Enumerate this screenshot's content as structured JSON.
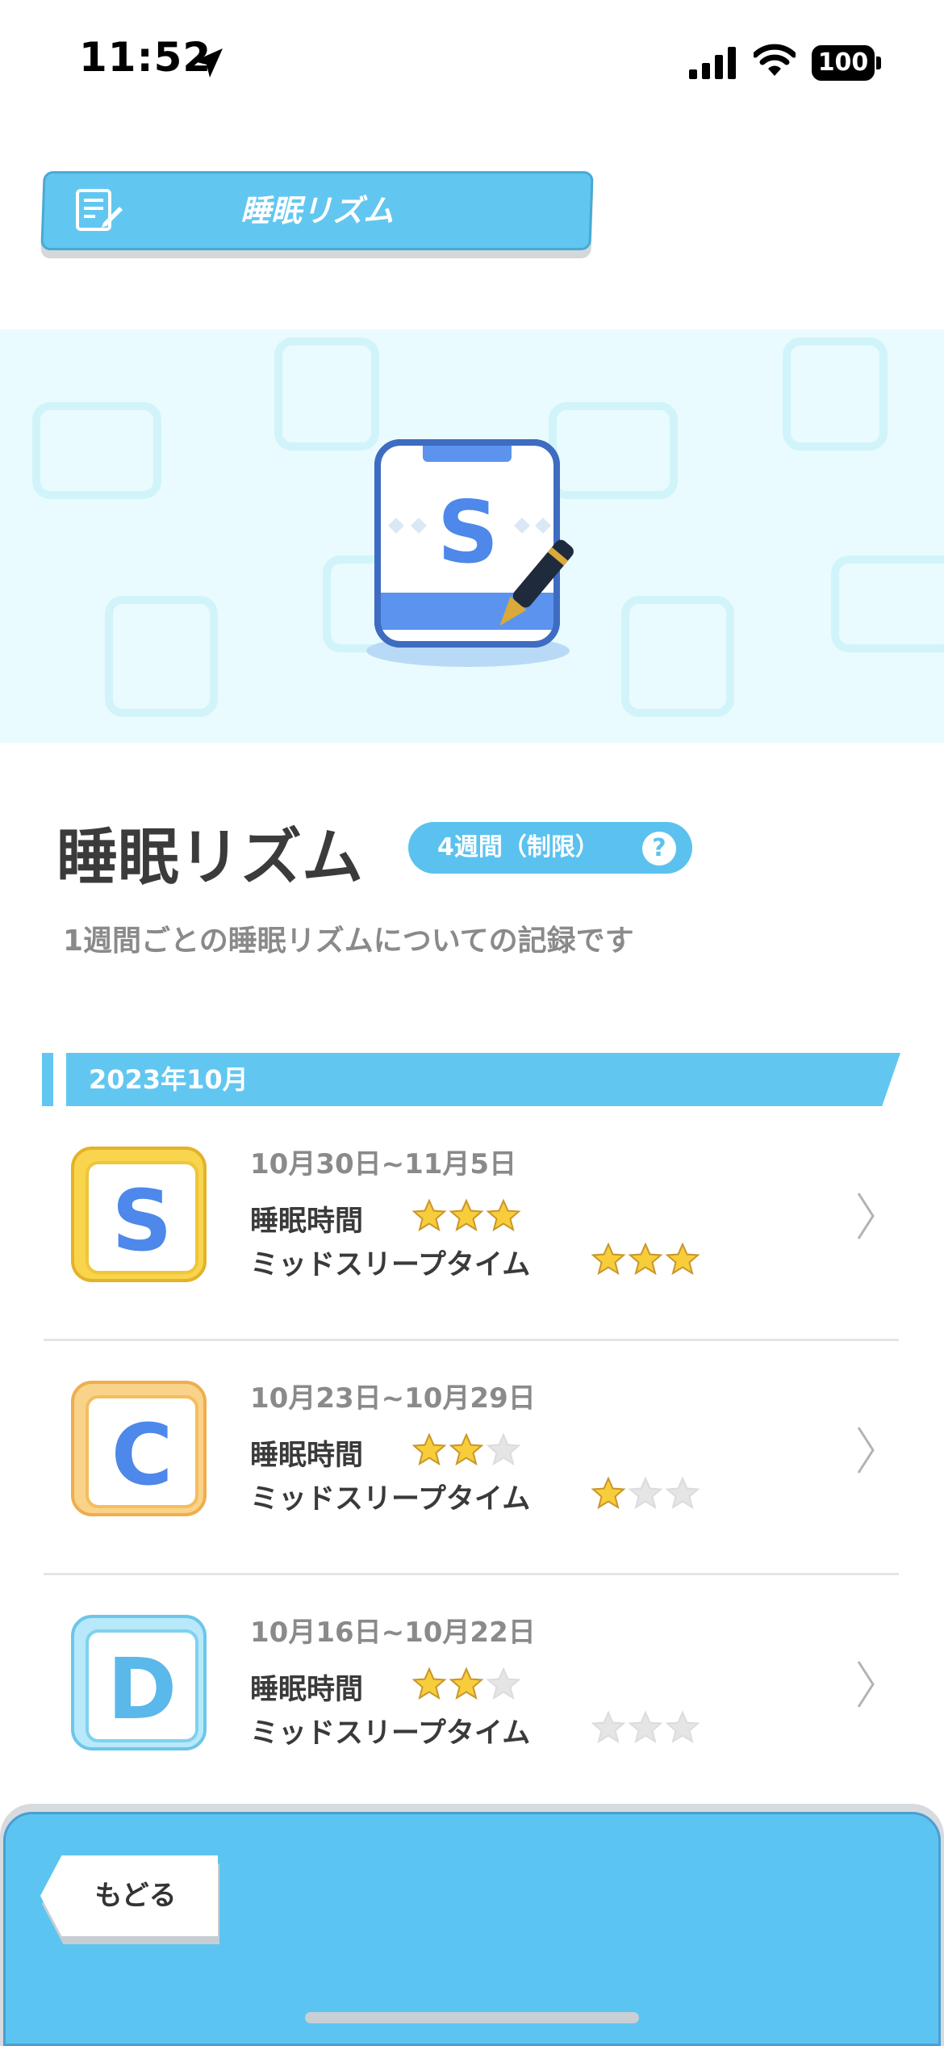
{
  "status_bar": {
    "time": "11:52",
    "battery": "100",
    "icons": [
      "location-arrow-icon",
      "cellular-signal-icon",
      "wifi-icon",
      "battery-icon"
    ]
  },
  "header": {
    "title": "睡眠リズム",
    "icon": "notepad-edit-icon"
  },
  "banner": {
    "badge_letter": "S",
    "icon": "clipboard-pen-icon"
  },
  "section": {
    "title": "睡眠リズム",
    "limit_label": "4週間（制限）",
    "help_label": "?",
    "subtitle": "1週間ごとの睡眠リズムについての記録です"
  },
  "month": {
    "label": "2023年10月"
  },
  "labels": {
    "sleep_time": "睡眠時間",
    "mid_sleep": "ミッドスリープタイム"
  },
  "records": [
    {
      "grade": "S",
      "range": "10月30日~11月5日",
      "sleep_time_stars": 3,
      "mid_sleep_stars": 3
    },
    {
      "grade": "C",
      "range": "10月23日~10月29日",
      "sleep_time_stars": 2,
      "mid_sleep_stars": 1
    },
    {
      "grade": "D",
      "range": "10月16日~10月22日",
      "sleep_time_stars": 2,
      "mid_sleep_stars": 0
    }
  ],
  "footer": {
    "back_label": "もどる"
  },
  "colors": {
    "accent": "#62c7f0",
    "star_on": "#f7cd3b",
    "star_off": "#e5e5e5",
    "grade_s": "#f3c93d",
    "grade_c": "#f5bf5d",
    "grade_d": "#8fd6f3"
  }
}
